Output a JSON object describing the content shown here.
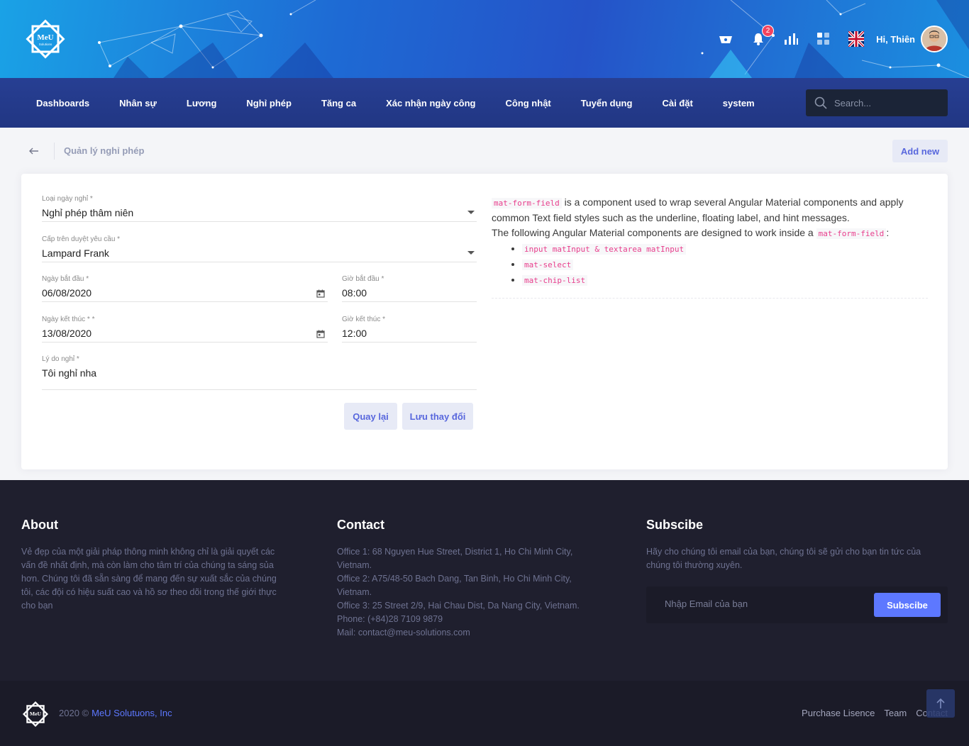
{
  "header": {
    "logo_text": "MeU Solutions",
    "notification_count": "2",
    "greeting": "Hi,",
    "user_name": "Thiên",
    "icons": [
      "basket-icon",
      "bell-icon",
      "bar-chart-icon",
      "apps-icon",
      "uk-flag-icon"
    ]
  },
  "nav": {
    "items": [
      "Dashboards",
      "Nhân sự",
      "Lương",
      "Nghỉ phép",
      "Tăng ca",
      "Xác nhận ngày công",
      "Công nhật",
      "Tuyển dụng",
      "Cài đặt",
      "system"
    ],
    "search_placeholder": "Search..."
  },
  "subheader": {
    "title": "Quản lý nghỉ phép",
    "add_new": "Add new"
  },
  "form": {
    "leave_type": {
      "label": "Loại ngày nghỉ *",
      "value": "Nghỉ phép thâm niên"
    },
    "approver": {
      "label": "Cấp trên duyệt yêu cầu *",
      "value": "Lampard Frank"
    },
    "start_date": {
      "label": "Ngày bắt đầu *",
      "value": "06/08/2020"
    },
    "start_time": {
      "label": "Giờ bắt đầu *",
      "value": "08:00"
    },
    "end_date": {
      "label": "Ngày kết thúc * *",
      "value": "13/08/2020"
    },
    "end_time": {
      "label": "Giờ kết thúc *",
      "value": "12:00"
    },
    "reason": {
      "label": "Lý do nghỉ *",
      "value": "Tôi nghỉ nha"
    },
    "back_button": "Quay lại",
    "save_button": "Lưu thay đổi"
  },
  "doc": {
    "code1": "mat-form-field",
    "text1": " is a component used to wrap several Angular Material components and apply common Text field styles such as the underline, floating label, and hint messages.",
    "text2": "The following Angular Material components are designed to work inside a ",
    "code2": "mat-form-field",
    "text3": ":",
    "list": [
      "input matInput & textarea matInput",
      "mat-select",
      "mat-chip-list"
    ]
  },
  "footer": {
    "about_title": "About",
    "about_text": "Vẻ đẹp của một giải pháp thông minh không chỉ là giải quyết các vấn đề nhất định, mà còn làm cho tâm trí của chúng ta sáng sủa hơn. Chúng tôi đã sẵn sàng để mang đến sự xuất sắc của chúng tôi, các đội có hiệu suất cao và hồ sơ theo dõi trong thế giới thực cho bạn",
    "contact_title": "Contact",
    "contact_lines": [
      "Office 1: 68 Nguyen Hue Street, District 1, Ho Chi Minh City, Vietnam.",
      "Office 2: A75/48-50 Bach Dang, Tan Binh, Ho Chi Minh City, Vietnam.",
      "Office 3: 25 Street 2/9, Hai Chau Dist, Da Nang City, Vietnam.",
      "Phone: (+84)28 7109 9879",
      "Mail: contact@meu-solutions.com"
    ],
    "subscribe_title": "Subscibe",
    "subscribe_text": "Hãy cho chúng tôi email của bạn, chúng tôi sẽ gửi cho bạn tin tức của chúng tôi thường xuyên.",
    "email_placeholder": "Nhập Email của bạn",
    "subscribe_button": "Subscibe"
  },
  "bottom": {
    "year": "2020 ©",
    "company": "MeU Solutuons, Inc",
    "links": [
      "Purchase Lisence",
      "Team",
      "Contact"
    ]
  },
  "colors": {
    "accent": "#5d78ff",
    "nav_bg": "#253c8f",
    "footer_bg": "#1f1f2e",
    "badge": "#f3435f"
  }
}
